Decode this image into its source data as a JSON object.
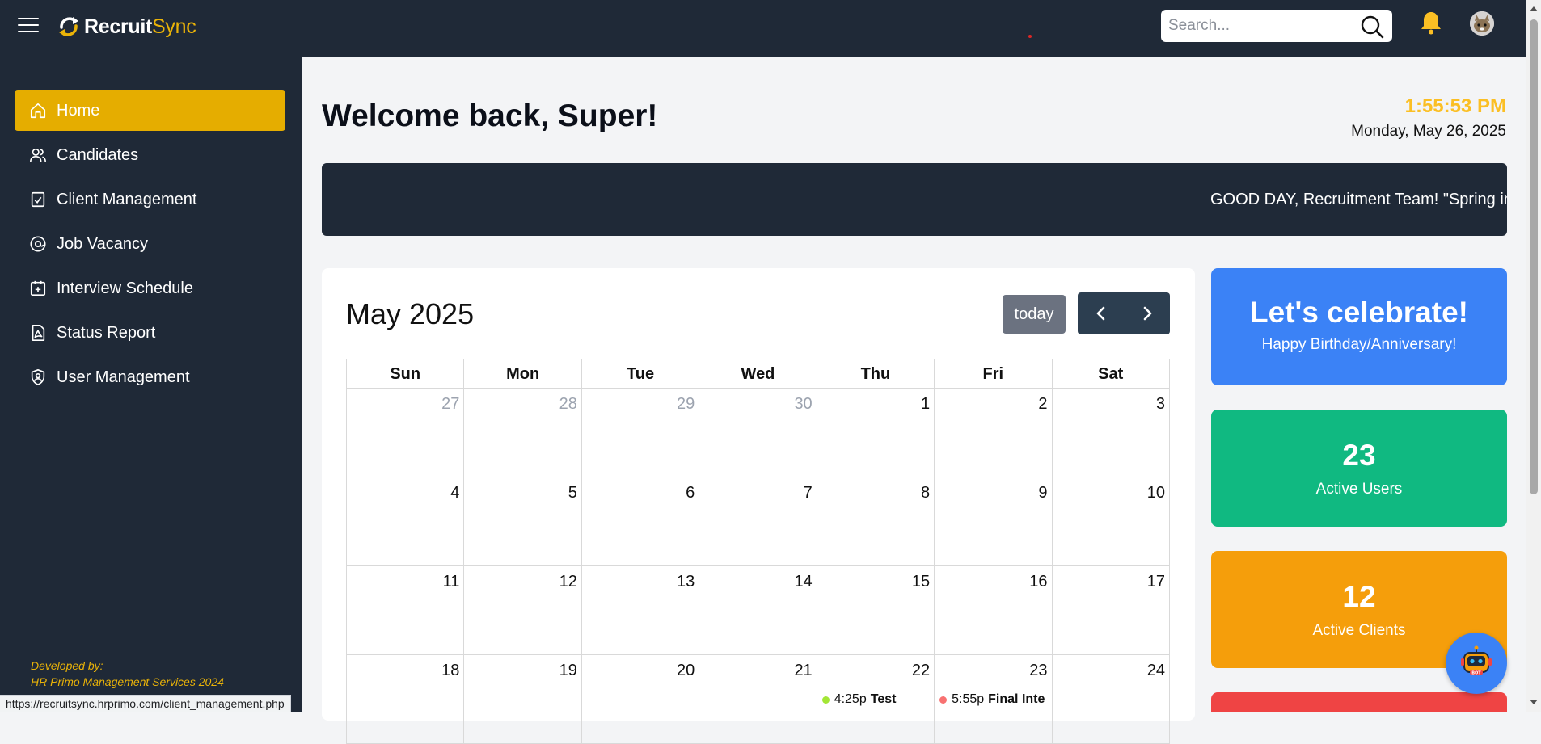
{
  "app": {
    "logo_bold": "Recruit",
    "logo_light": "Sync"
  },
  "header": {
    "search_placeholder": "Search..."
  },
  "sidebar": {
    "items": [
      {
        "label": "Home",
        "icon": "home-icon",
        "active": true
      },
      {
        "label": "Candidates",
        "icon": "users-icon",
        "active": false
      },
      {
        "label": "Client Management",
        "icon": "clipboard-check-icon",
        "active": false
      },
      {
        "label": "Job Vacancy",
        "icon": "at-sign-icon",
        "active": false
      },
      {
        "label": "Interview Schedule",
        "icon": "calendar-plus-icon",
        "active": false
      },
      {
        "label": "Status Report",
        "icon": "file-report-icon",
        "active": false
      },
      {
        "label": "User Management",
        "icon": "shield-user-icon",
        "active": false
      }
    ],
    "footer_line1": "Developed by:",
    "footer_line2": "HR Primo Management Services 2024"
  },
  "main": {
    "welcome": "Welcome back, Super!",
    "time": "1:55:53 PM",
    "date": "Monday, May 26, 2025",
    "ticker": "GOOD DAY, Recruitment Team! \"Spring in"
  },
  "calendar": {
    "title": "May 2025",
    "today_label": "today",
    "weekdays": [
      "Sun",
      "Mon",
      "Tue",
      "Wed",
      "Thu",
      "Fri",
      "Sat"
    ],
    "weeks": [
      [
        {
          "day": "27",
          "other": true
        },
        {
          "day": "28",
          "other": true
        },
        {
          "day": "29",
          "other": true
        },
        {
          "day": "30",
          "other": true
        },
        {
          "day": "1"
        },
        {
          "day": "2"
        },
        {
          "day": "3"
        }
      ],
      [
        {
          "day": "4"
        },
        {
          "day": "5"
        },
        {
          "day": "6"
        },
        {
          "day": "7"
        },
        {
          "day": "8"
        },
        {
          "day": "9"
        },
        {
          "day": "10"
        }
      ],
      [
        {
          "day": "11"
        },
        {
          "day": "12"
        },
        {
          "day": "13"
        },
        {
          "day": "14"
        },
        {
          "day": "15"
        },
        {
          "day": "16"
        },
        {
          "day": "17"
        }
      ],
      [
        {
          "day": "18"
        },
        {
          "day": "19"
        },
        {
          "day": "20"
        },
        {
          "day": "21"
        },
        {
          "day": "22",
          "event": {
            "time": "4:25p",
            "title": "Test",
            "color": "#a3e635"
          }
        },
        {
          "day": "23",
          "event": {
            "time": "5:55p",
            "title": "Final Inte",
            "color": "#f87171"
          }
        },
        {
          "day": "24"
        }
      ]
    ]
  },
  "tiles": {
    "celebrate_title": "Let's celebrate!",
    "celebrate_sub": "Happy Birthday/Anniversary!",
    "users_count": "23",
    "users_label": "Active Users",
    "clients_count": "12",
    "clients_label": "Active Clients"
  },
  "chatbot": {
    "badge": "BOT"
  },
  "statusbar": {
    "url": "https://recruitsync.hrprimo.com/client_management.php"
  },
  "colors": {
    "header_bg": "#1f2937",
    "active_nav": "#e5ad00",
    "time": "#fbbf24",
    "tile_blue": "#3b82f6",
    "tile_green": "#10b981",
    "tile_orange": "#f59e0b",
    "tile_red": "#ef4444"
  }
}
